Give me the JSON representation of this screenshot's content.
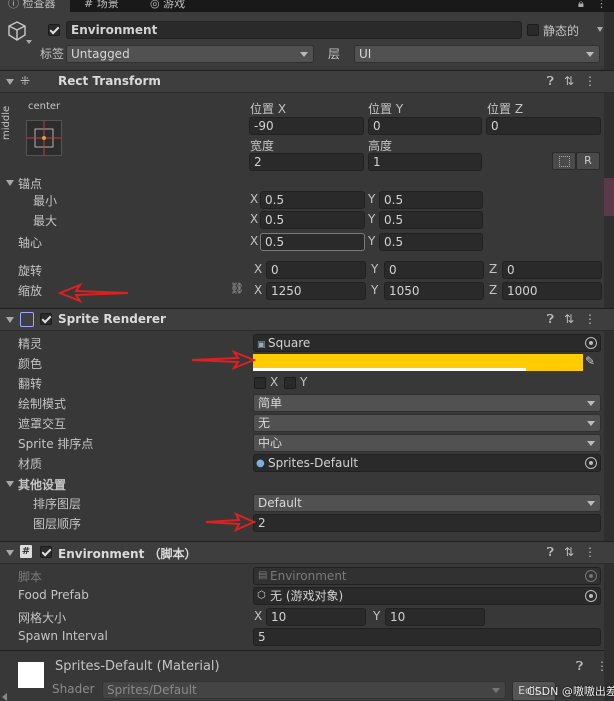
{
  "tabs": [
    "检查器",
    "场景",
    "游戏"
  ],
  "object": {
    "name": "Environment",
    "static_label": "静态的",
    "tag_label": "标签",
    "tag_value": "Untagged",
    "layer_label": "层",
    "layer_value": "UI"
  },
  "rect_transform": {
    "title": "Rect Transform",
    "anchor_preset_h": "center",
    "anchor_preset_v": "middle",
    "pos_x_label": "位置 X",
    "pos_y_label": "位置 Y",
    "pos_z_label": "位置 Z",
    "pos_x": "-90",
    "pos_y": "0",
    "pos_z": "0",
    "width_label": "宽度",
    "height_label": "高度",
    "width": "2",
    "height": "1",
    "r_button": "R",
    "anchors_label": "锚点",
    "min_label": "最小",
    "max_label": "最大",
    "pivot_label": "轴心",
    "min_x": "0.5",
    "min_y": "0.5",
    "max_x": "0.5",
    "max_y": "0.5",
    "pivot_x": "0.5",
    "pivot_y": "0.5",
    "rotation_label": "旋转",
    "rot_x": "0",
    "rot_y": "0",
    "rot_z": "0",
    "scale_label": "缩放",
    "scale_x": "1250",
    "scale_y": "1050",
    "scale_z": "1000",
    "x": "X",
    "y": "Y",
    "z": "Z"
  },
  "sprite_renderer": {
    "title": "Sprite Renderer",
    "sprite_label": "精灵",
    "sprite_value": "Square",
    "color_label": "颜色",
    "color_value": "#FFCC00",
    "flip_label": "翻转",
    "flip_x": "X",
    "flip_y": "Y",
    "draw_mode_label": "绘制模式",
    "draw_mode_value": "简单",
    "mask_label": "遮罩交互",
    "mask_value": "无",
    "sort_point_label": "Sprite 排序点",
    "sort_point_value": "中心",
    "material_label": "材质",
    "material_value": "Sprites-Default",
    "additional_label": "其他设置",
    "sorting_layer_label": "排序图层",
    "sorting_layer_value": "Default",
    "order_label": "图层顺序",
    "order_value": "2"
  },
  "script_comp": {
    "title": "Environment （脚本）",
    "script_label": "脚本",
    "script_value": "Environment",
    "food_prefab_label": "Food Prefab",
    "food_prefab_value": "无 (游戏对象)",
    "grid_label": "网格大小",
    "grid_x": "10",
    "grid_y": "10",
    "spawn_label": "Spawn Interval",
    "spawn_value": "5"
  },
  "material": {
    "title": "Sprites-Default (Material)",
    "shader_label": "Shader",
    "shader_value": "Sprites/Default",
    "edit_button": "Edit...",
    "watermark": "CSDN @嗷嗷出差"
  }
}
